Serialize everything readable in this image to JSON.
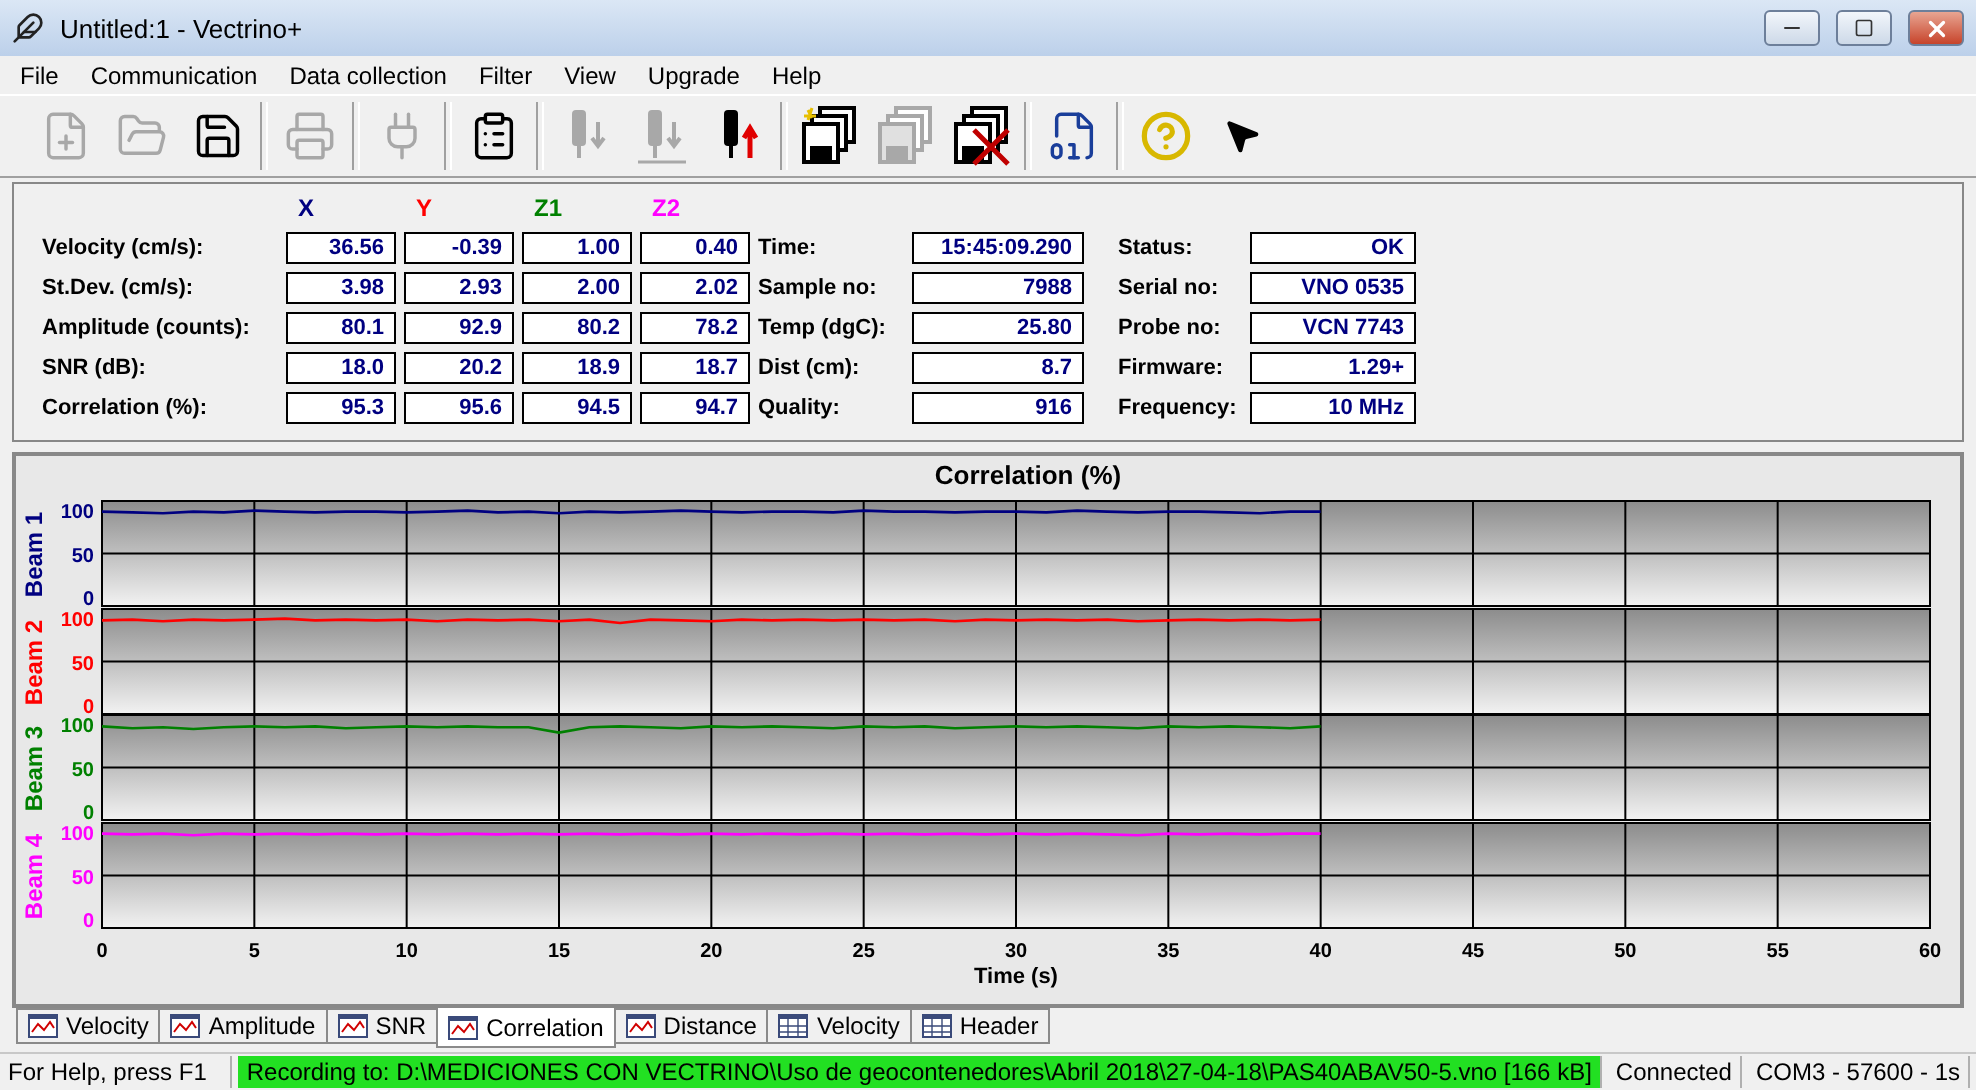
{
  "window": {
    "title": "Untitled:1 - Vectrino+"
  },
  "menu": [
    "File",
    "Communication",
    "Data collection",
    "Filter",
    "View",
    "Upgrade",
    "Help"
  ],
  "toolbar": [
    {
      "kind": "new",
      "disabled": true
    },
    {
      "kind": "open",
      "disabled": true
    },
    {
      "kind": "save",
      "disabled": false
    },
    {
      "kind": "print",
      "disabled": true
    },
    {
      "kind": "connect",
      "disabled": true
    },
    {
      "kind": "config",
      "disabled": false
    },
    {
      "kind": "probe_down",
      "disabled": true
    },
    {
      "kind": "probe_ground",
      "disabled": true
    },
    {
      "kind": "probe_up",
      "disabled": false
    },
    {
      "kind": "record",
      "disabled": false
    },
    {
      "kind": "record_stack",
      "disabled": true
    },
    {
      "kind": "stop",
      "disabled": false
    },
    {
      "kind": "convert",
      "disabled": false
    },
    {
      "kind": "help",
      "disabled": false
    },
    {
      "kind": "context_help",
      "disabled": false
    }
  ],
  "readings": {
    "columns": [
      {
        "label": "X",
        "color": "#000080"
      },
      {
        "label": "Y",
        "color": "#ff0000"
      },
      {
        "label": "Z1",
        "color": "#008000"
      },
      {
        "label": "Z2",
        "color": "#ff00ff"
      }
    ],
    "rows": [
      {
        "label": "Velocity (cm/s):",
        "values": [
          "36.56",
          "-0.39",
          "1.00",
          "0.40"
        ]
      },
      {
        "label": "St.Dev. (cm/s):",
        "values": [
          "3.98",
          "2.93",
          "2.00",
          "2.02"
        ]
      },
      {
        "label": "Amplitude (counts):",
        "values": [
          "80.1",
          "92.9",
          "80.2",
          "78.2"
        ]
      },
      {
        "label": "SNR (dB):",
        "values": [
          "18.0",
          "20.2",
          "18.9",
          "18.7"
        ]
      },
      {
        "label": "Correlation (%):",
        "values": [
          "95.3",
          "95.6",
          "94.5",
          "94.7"
        ]
      }
    ],
    "info": [
      {
        "label": "Time:",
        "value": "15:45:09.290"
      },
      {
        "label": "Sample no:",
        "value": "7988"
      },
      {
        "label": "Temp (dgC):",
        "value": "25.80"
      },
      {
        "label": "Dist (cm):",
        "value": "8.7"
      },
      {
        "label": "Quality:",
        "value": "916"
      }
    ],
    "status": [
      {
        "label": "Status:",
        "value": "OK"
      },
      {
        "label": "Serial no:",
        "value": "VNO 0535"
      },
      {
        "label": "Probe no:",
        "value": "VCN 7743"
      },
      {
        "label": "Firmware:",
        "value": "1.29+"
      },
      {
        "label": "Frequency:",
        "value": "10 MHz"
      }
    ]
  },
  "chart": {
    "title": "Correlation (%)",
    "panels": [
      {
        "chart_data": {
          "type": "line",
          "xlim": [
            0,
            60
          ],
          "ylim": [
            -10,
            110
          ],
          "yticks": [
            0,
            50,
            100
          ],
          "grid": true,
          "x": [
            0,
            1,
            2,
            3,
            4,
            5,
            6,
            7,
            8,
            9,
            10,
            11,
            12,
            13,
            14,
            15,
            16,
            17,
            18,
            19,
            20,
            21,
            22,
            23,
            24,
            25,
            26,
            27,
            28,
            29,
            30,
            31,
            32,
            33,
            34,
            35,
            36,
            37,
            38,
            39,
            40
          ],
          "series": [
            {
              "name": "Beam 1",
              "color": "#000080",
              "values": [
                98,
                97,
                96,
                98,
                97,
                99,
                98,
                97,
                98,
                98,
                97,
                98,
                99,
                97,
                98,
                96,
                98,
                97,
                98,
                99,
                98,
                97,
                98,
                98,
                97,
                99,
                98,
                98,
                97,
                98,
                98,
                97,
                99,
                98,
                97,
                98,
                98,
                97,
                96,
                98,
                98
              ]
            }
          ]
        }
      },
      {
        "chart_data": {
          "type": "line",
          "xlim": [
            0,
            60
          ],
          "ylim": [
            -10,
            110
          ],
          "yticks": [
            0,
            50,
            100
          ],
          "grid": true,
          "x": [
            0,
            1,
            2,
            3,
            4,
            5,
            6,
            7,
            8,
            9,
            10,
            11,
            12,
            13,
            14,
            15,
            16,
            17,
            18,
            19,
            20,
            21,
            22,
            23,
            24,
            25,
            26,
            27,
            28,
            29,
            30,
            31,
            32,
            33,
            34,
            35,
            36,
            37,
            38,
            39,
            40
          ],
          "series": [
            {
              "name": "Beam 2",
              "color": "#ff0000",
              "values": [
                97,
                98,
                96,
                98,
                97,
                98,
                99,
                97,
                98,
                97,
                98,
                96,
                98,
                97,
                98,
                96,
                98,
                94,
                98,
                97,
                96,
                98,
                97,
                98,
                97,
                98,
                97,
                98,
                96,
                98,
                97,
                98,
                97,
                98,
                96,
                97,
                98,
                97,
                98,
                97,
                98
              ]
            }
          ]
        }
      },
      {
        "chart_data": {
          "type": "line",
          "xlim": [
            0,
            60
          ],
          "ylim": [
            -10,
            110
          ],
          "yticks": [
            0,
            50,
            100
          ],
          "grid": true,
          "x": [
            0,
            1,
            2,
            3,
            4,
            5,
            6,
            7,
            8,
            9,
            10,
            11,
            12,
            13,
            14,
            15,
            16,
            17,
            18,
            19,
            20,
            21,
            22,
            23,
            24,
            25,
            26,
            27,
            28,
            29,
            30,
            31,
            32,
            33,
            34,
            35,
            36,
            37,
            38,
            39,
            40
          ],
          "series": [
            {
              "name": "Beam 3",
              "color": "#008000",
              "values": [
                97,
                95,
                96,
                94,
                96,
                97,
                96,
                97,
                95,
                96,
                97,
                96,
                97,
                96,
                96,
                90,
                96,
                97,
                96,
                95,
                97,
                96,
                97,
                96,
                95,
                97,
                96,
                97,
                95,
                96,
                97,
                96,
                97,
                96,
                95,
                97,
                96,
                97,
                96,
                95,
                97
              ]
            }
          ]
        }
      },
      {
        "chart_data": {
          "type": "line",
          "xlabel": "Time (s)",
          "xlim": [
            0,
            60
          ],
          "ylim": [
            -10,
            110
          ],
          "xticks": [
            0,
            5,
            10,
            15,
            20,
            25,
            30,
            35,
            40,
            45,
            50,
            55,
            60
          ],
          "yticks": [
            0,
            50,
            100
          ],
          "grid": true,
          "x": [
            0,
            1,
            2,
            3,
            4,
            5,
            6,
            7,
            8,
            9,
            10,
            11,
            12,
            13,
            14,
            15,
            16,
            17,
            18,
            19,
            20,
            21,
            22,
            23,
            24,
            25,
            26,
            27,
            28,
            29,
            30,
            31,
            32,
            33,
            34,
            35,
            36,
            37,
            38,
            39,
            40
          ],
          "series": [
            {
              "name": "Beam 4",
              "color": "#ff00ff",
              "values": [
                98,
                97,
                98,
                96,
                98,
                97,
                98,
                97,
                98,
                97,
                98,
                97,
                98,
                97,
                98,
                97,
                98,
                97,
                98,
                97,
                98,
                97,
                98,
                97,
                98,
                97,
                98,
                97,
                98,
                97,
                98,
                97,
                98,
                97,
                96,
                98,
                97,
                98,
                97,
                98,
                98
              ]
            }
          ]
        }
      }
    ]
  },
  "tabs": [
    {
      "label": "Velocity",
      "kind": "chart",
      "selected": false
    },
    {
      "label": "Amplitude",
      "kind": "chart",
      "selected": false
    },
    {
      "label": "SNR",
      "kind": "chart",
      "selected": false
    },
    {
      "label": "Correlation",
      "kind": "chart",
      "selected": true
    },
    {
      "label": "Distance",
      "kind": "chart",
      "selected": false
    },
    {
      "label": "Velocity",
      "kind": "table",
      "selected": false
    },
    {
      "label": "Header",
      "kind": "table",
      "selected": false
    }
  ],
  "status_bar": [
    {
      "text": "For Help, press F1",
      "kind": "help"
    },
    {
      "text": "Recording to: D:\\MEDICIONES CON VECTRINO\\Uso de geocontenedores\\Abril 2018\\27-04-18\\PAS40ABAV50-5.vno [166 kB]",
      "kind": "recording"
    },
    {
      "text": "Connected",
      "kind": "plain"
    },
    {
      "text": "COM3 - 57600 - 1s",
      "kind": "plain"
    }
  ]
}
